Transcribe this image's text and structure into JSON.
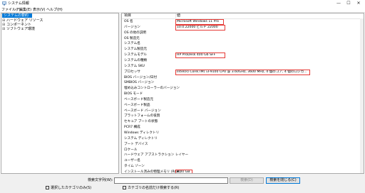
{
  "window": {
    "title": "システム情報",
    "controls": [
      "—",
      "☐",
      "✕"
    ]
  },
  "menubar": [
    "ファイル(F)",
    "編集(E)",
    "表示(V)",
    "ヘルプ(H)"
  ],
  "tree": [
    {
      "label": "システムの要約",
      "selected": true,
      "expand": ""
    },
    {
      "label": "ハードウェア リソース",
      "selected": false,
      "expand": "⊞"
    },
    {
      "label": "コンポーネント",
      "selected": false,
      "expand": "⊞"
    },
    {
      "label": "ソフトウェア環境",
      "selected": false,
      "expand": "⊞"
    }
  ],
  "list": {
    "headers": {
      "item": "項目",
      "value": "値"
    },
    "rows": [
      {
        "item": "OS 名",
        "value": "Microsoft Windows 11 Pro",
        "highlight": true
      },
      {
        "item": "バージョン",
        "value": "10.0.22000 ビルド 22000",
        "highlight": true
      },
      {
        "item": "OS の他の説明",
        "value": ""
      },
      {
        "item": "OS 製造元",
        "value": ""
      },
      {
        "item": "システム名",
        "value": ""
      },
      {
        "item": "システム製造元",
        "value": ""
      },
      {
        "item": "システムモデル",
        "value": "HP ProDesk 400 G6 SFF",
        "highlight": true
      },
      {
        "item": "システムの種類",
        "value": ""
      },
      {
        "item": "システム SKU",
        "value": ""
      },
      {
        "item": "プロセッサ",
        "value": "Intel(R) Core(TM) i3-9100 CPU @ 3.60GHz, 3600 MHz, 4 個のコア, 4 個のロジカ...",
        "highlight": true
      },
      {
        "item": "BIOS バージョン/日付",
        "value": ""
      },
      {
        "item": "SMBIOS バージョン",
        "value": ""
      },
      {
        "item": "埋め込みコントローラーのバージョン",
        "value": ""
      },
      {
        "item": "BIOS モード",
        "value": ""
      },
      {
        "item": "ベースボード製造元",
        "value": ""
      },
      {
        "item": "ベースボード製品",
        "value": ""
      },
      {
        "item": "ベースボード バージョン",
        "value": ""
      },
      {
        "item": "プラットフォームの役割",
        "value": ""
      },
      {
        "item": "セキュア ブートの状態",
        "value": ""
      },
      {
        "item": "PCR7 構成",
        "value": ""
      },
      {
        "item": "Windows ディレクトリ",
        "value": ""
      },
      {
        "item": "システム ディレクトリ",
        "value": ""
      },
      {
        "item": "ブート デバイス",
        "value": ""
      },
      {
        "item": "ロケール",
        "value": ""
      },
      {
        "item": "ハードウェア アブストラクション レイヤー",
        "value": ""
      },
      {
        "item": "ユーザー名",
        "value": ""
      },
      {
        "item": "タイム ゾーン",
        "value": ""
      },
      {
        "item": "インストール済みの物理メモリ (RAM)",
        "value": "8.00 GB",
        "highlight": true
      }
    ]
  },
  "footer": {
    "search_label": "検索文字列(W):",
    "search_value": "",
    "search_button": "検索(D)",
    "close_search_button": "検索を閉じる(C)",
    "check_selected_only": "選択したカテゴリのみ(S)",
    "check_category_names_only": "カテゴリの名前だけ検索する(R)"
  },
  "colors": {
    "selection": "#0078d7",
    "highlight_border": "#e53935"
  },
  "icons": {
    "app": "system-info-icon",
    "scroll": "scrollbar"
  }
}
